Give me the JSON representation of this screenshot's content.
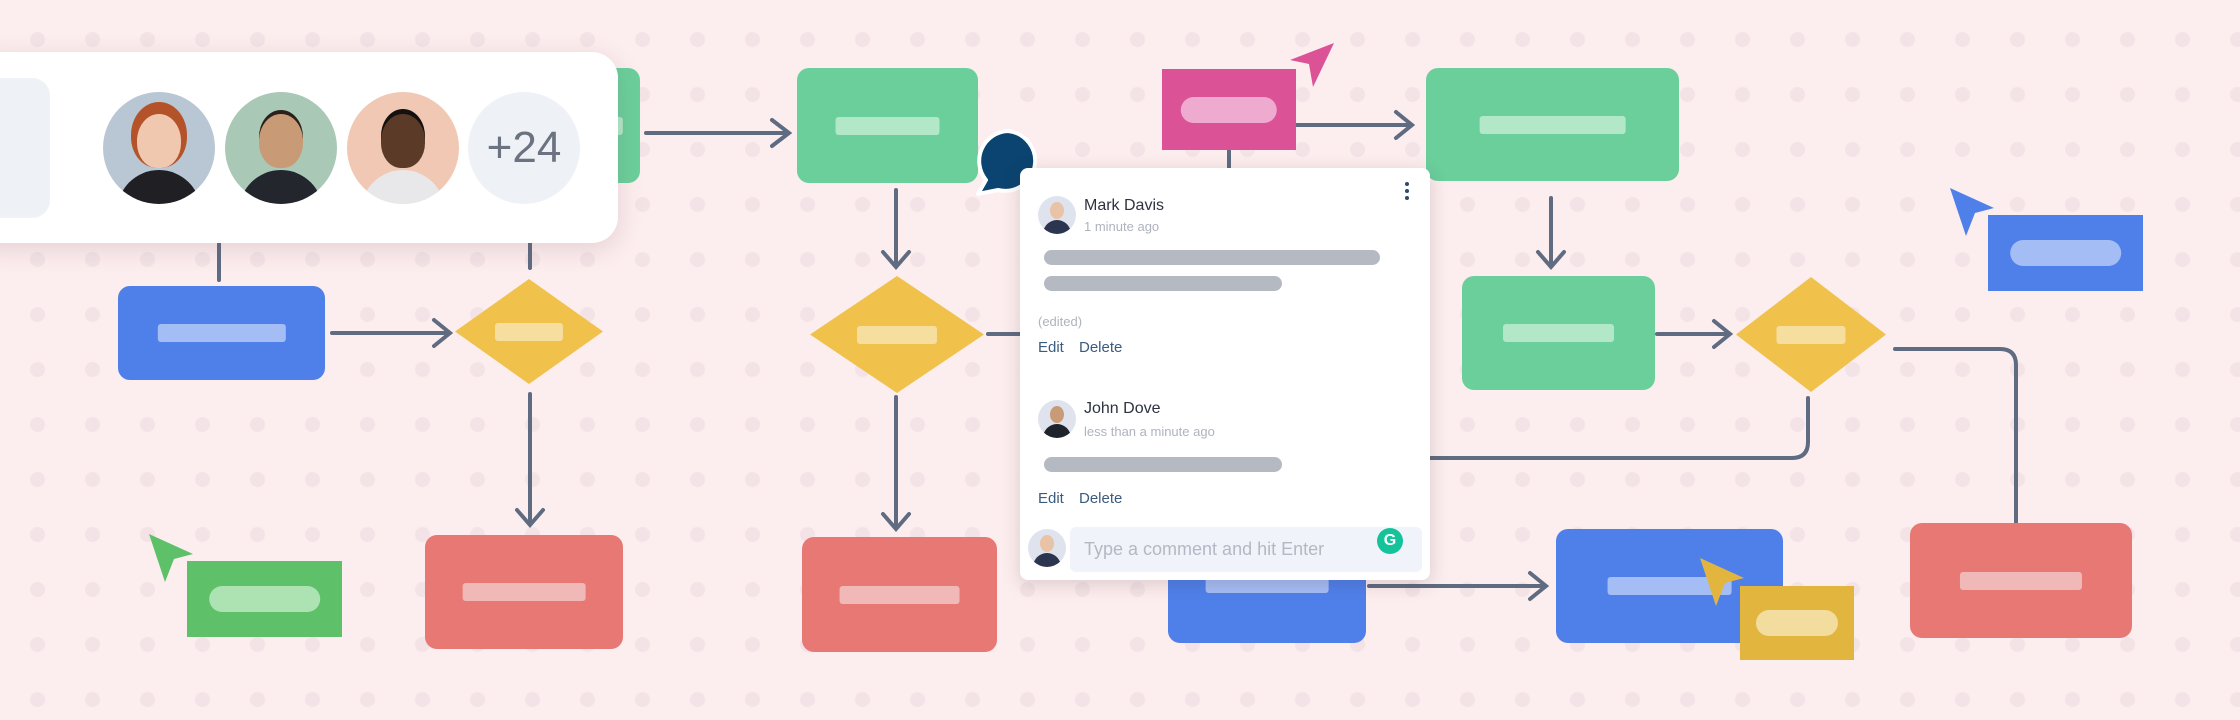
{
  "collaborators": {
    "avatars": [
      {
        "name": "collaborator-1",
        "bg": "#b9c7d4",
        "hair": "#b4532a",
        "skin": "#f0c8b0",
        "shirt": "#1f1f24"
      },
      {
        "name": "collaborator-2",
        "bg": "#a9c9b6",
        "hair": "#2a211c",
        "skin": "#c99a76",
        "shirt": "#23262d"
      },
      {
        "name": "collaborator-3",
        "bg": "#f1c8b4",
        "hair": "#141111",
        "skin": "#5b3a28",
        "shirt": "#e8e8ea"
      }
    ],
    "more_count": "+24"
  },
  "comments": {
    "items": [
      {
        "author": "Mark Davis",
        "time": "1 minute ago",
        "edited": "(edited)",
        "edit_label": "Edit",
        "delete_label": "Delete"
      },
      {
        "author": "John Dove",
        "time": "less than a minute ago",
        "edit_label": "Edit",
        "delete_label": "Delete"
      }
    ],
    "input_placeholder": "Type a comment and hit Enter",
    "grammarly_glyph": "G"
  },
  "colors": {
    "green": "#6acf9b",
    "blue": "#4f80ea",
    "red": "#e77874",
    "yellow": "#f0c14b",
    "pink": "#dc5296",
    "sticky_green": "#5fc06a",
    "sticky_yellow": "#e2b53f",
    "connector": "#5f6b80",
    "comment_bubble": "#0b4470",
    "link": "#3b5b7f"
  }
}
